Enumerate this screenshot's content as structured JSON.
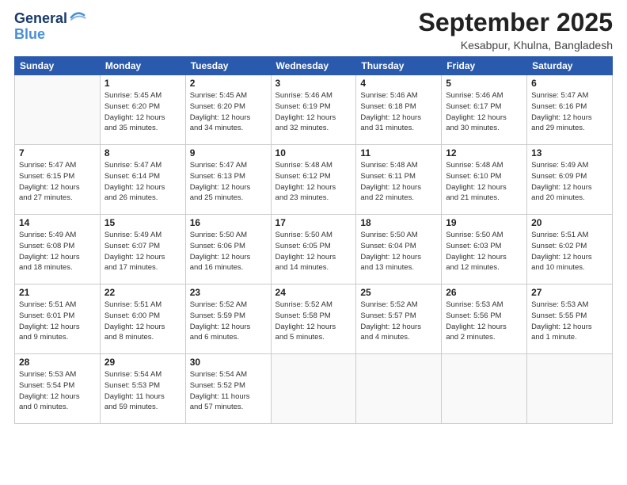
{
  "header": {
    "logo_line1": "General",
    "logo_line2": "Blue",
    "title": "September 2025",
    "location": "Kesabpur, Khulna, Bangladesh"
  },
  "days_of_week": [
    "Sunday",
    "Monday",
    "Tuesday",
    "Wednesday",
    "Thursday",
    "Friday",
    "Saturday"
  ],
  "weeks": [
    [
      {
        "day": "",
        "info": ""
      },
      {
        "day": "1",
        "info": "Sunrise: 5:45 AM\nSunset: 6:20 PM\nDaylight: 12 hours\nand 35 minutes."
      },
      {
        "day": "2",
        "info": "Sunrise: 5:45 AM\nSunset: 6:20 PM\nDaylight: 12 hours\nand 34 minutes."
      },
      {
        "day": "3",
        "info": "Sunrise: 5:46 AM\nSunset: 6:19 PM\nDaylight: 12 hours\nand 32 minutes."
      },
      {
        "day": "4",
        "info": "Sunrise: 5:46 AM\nSunset: 6:18 PM\nDaylight: 12 hours\nand 31 minutes."
      },
      {
        "day": "5",
        "info": "Sunrise: 5:46 AM\nSunset: 6:17 PM\nDaylight: 12 hours\nand 30 minutes."
      },
      {
        "day": "6",
        "info": "Sunrise: 5:47 AM\nSunset: 6:16 PM\nDaylight: 12 hours\nand 29 minutes."
      }
    ],
    [
      {
        "day": "7",
        "info": "Sunrise: 5:47 AM\nSunset: 6:15 PM\nDaylight: 12 hours\nand 27 minutes."
      },
      {
        "day": "8",
        "info": "Sunrise: 5:47 AM\nSunset: 6:14 PM\nDaylight: 12 hours\nand 26 minutes."
      },
      {
        "day": "9",
        "info": "Sunrise: 5:47 AM\nSunset: 6:13 PM\nDaylight: 12 hours\nand 25 minutes."
      },
      {
        "day": "10",
        "info": "Sunrise: 5:48 AM\nSunset: 6:12 PM\nDaylight: 12 hours\nand 23 minutes."
      },
      {
        "day": "11",
        "info": "Sunrise: 5:48 AM\nSunset: 6:11 PM\nDaylight: 12 hours\nand 22 minutes."
      },
      {
        "day": "12",
        "info": "Sunrise: 5:48 AM\nSunset: 6:10 PM\nDaylight: 12 hours\nand 21 minutes."
      },
      {
        "day": "13",
        "info": "Sunrise: 5:49 AM\nSunset: 6:09 PM\nDaylight: 12 hours\nand 20 minutes."
      }
    ],
    [
      {
        "day": "14",
        "info": "Sunrise: 5:49 AM\nSunset: 6:08 PM\nDaylight: 12 hours\nand 18 minutes."
      },
      {
        "day": "15",
        "info": "Sunrise: 5:49 AM\nSunset: 6:07 PM\nDaylight: 12 hours\nand 17 minutes."
      },
      {
        "day": "16",
        "info": "Sunrise: 5:50 AM\nSunset: 6:06 PM\nDaylight: 12 hours\nand 16 minutes."
      },
      {
        "day": "17",
        "info": "Sunrise: 5:50 AM\nSunset: 6:05 PM\nDaylight: 12 hours\nand 14 minutes."
      },
      {
        "day": "18",
        "info": "Sunrise: 5:50 AM\nSunset: 6:04 PM\nDaylight: 12 hours\nand 13 minutes."
      },
      {
        "day": "19",
        "info": "Sunrise: 5:50 AM\nSunset: 6:03 PM\nDaylight: 12 hours\nand 12 minutes."
      },
      {
        "day": "20",
        "info": "Sunrise: 5:51 AM\nSunset: 6:02 PM\nDaylight: 12 hours\nand 10 minutes."
      }
    ],
    [
      {
        "day": "21",
        "info": "Sunrise: 5:51 AM\nSunset: 6:01 PM\nDaylight: 12 hours\nand 9 minutes."
      },
      {
        "day": "22",
        "info": "Sunrise: 5:51 AM\nSunset: 6:00 PM\nDaylight: 12 hours\nand 8 minutes."
      },
      {
        "day": "23",
        "info": "Sunrise: 5:52 AM\nSunset: 5:59 PM\nDaylight: 12 hours\nand 6 minutes."
      },
      {
        "day": "24",
        "info": "Sunrise: 5:52 AM\nSunset: 5:58 PM\nDaylight: 12 hours\nand 5 minutes."
      },
      {
        "day": "25",
        "info": "Sunrise: 5:52 AM\nSunset: 5:57 PM\nDaylight: 12 hours\nand 4 minutes."
      },
      {
        "day": "26",
        "info": "Sunrise: 5:53 AM\nSunset: 5:56 PM\nDaylight: 12 hours\nand 2 minutes."
      },
      {
        "day": "27",
        "info": "Sunrise: 5:53 AM\nSunset: 5:55 PM\nDaylight: 12 hours\nand 1 minute."
      }
    ],
    [
      {
        "day": "28",
        "info": "Sunrise: 5:53 AM\nSunset: 5:54 PM\nDaylight: 12 hours\nand 0 minutes."
      },
      {
        "day": "29",
        "info": "Sunrise: 5:54 AM\nSunset: 5:53 PM\nDaylight: 11 hours\nand 59 minutes."
      },
      {
        "day": "30",
        "info": "Sunrise: 5:54 AM\nSunset: 5:52 PM\nDaylight: 11 hours\nand 57 minutes."
      },
      {
        "day": "",
        "info": ""
      },
      {
        "day": "",
        "info": ""
      },
      {
        "day": "",
        "info": ""
      },
      {
        "day": "",
        "info": ""
      }
    ]
  ]
}
